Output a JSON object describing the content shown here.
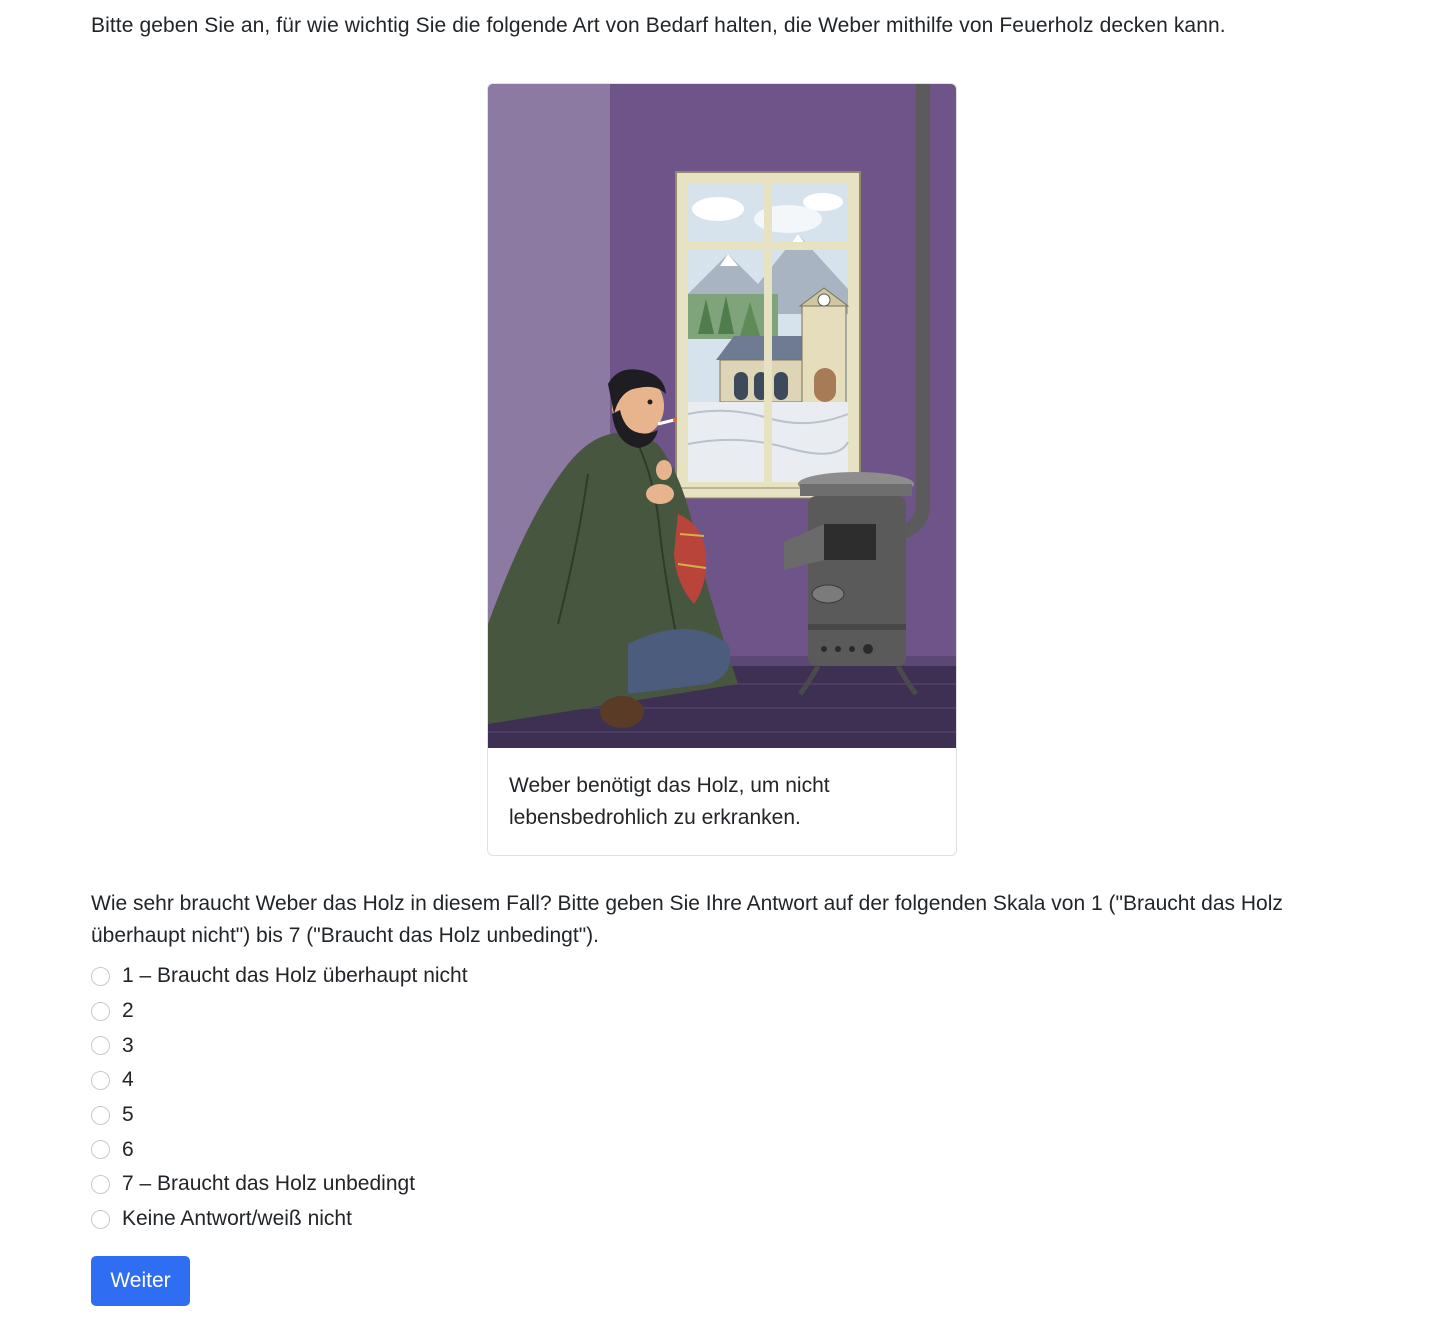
{
  "intro_text": "Bitte geben Sie an, für wie wichtig Sie die folgende Art von Bedarf halten, die Weber mithilfe von Feuerholz decken kann.",
  "card": {
    "caption": "Weber benötigt das Holz, um nicht lebensbedrohlich zu erkranken."
  },
  "question_text": "Wie sehr braucht Weber das Holz in diesem Fall? Bitte geben Sie Ihre Antwort auf der folgenden Skala von 1 (\"Braucht das Holz überhaupt nicht\") bis 7 (\"Braucht das Holz unbedingt\").",
  "options": [
    {
      "label": "1 – Braucht das Holz überhaupt nicht",
      "selected": false
    },
    {
      "label": "2",
      "selected": false
    },
    {
      "label": "3",
      "selected": false
    },
    {
      "label": "4",
      "selected": false
    },
    {
      "label": "5",
      "selected": false
    },
    {
      "label": "6",
      "selected": false
    },
    {
      "label": "7 – Braucht das Holz unbedingt",
      "selected": false
    },
    {
      "label": "Keine Antwort/weiß nicht",
      "selected": false
    }
  ],
  "next_button_label": "Weiter",
  "colors": {
    "button": "#2f6ef2",
    "wall": "#6f5489",
    "cloak": "#47573f"
  }
}
